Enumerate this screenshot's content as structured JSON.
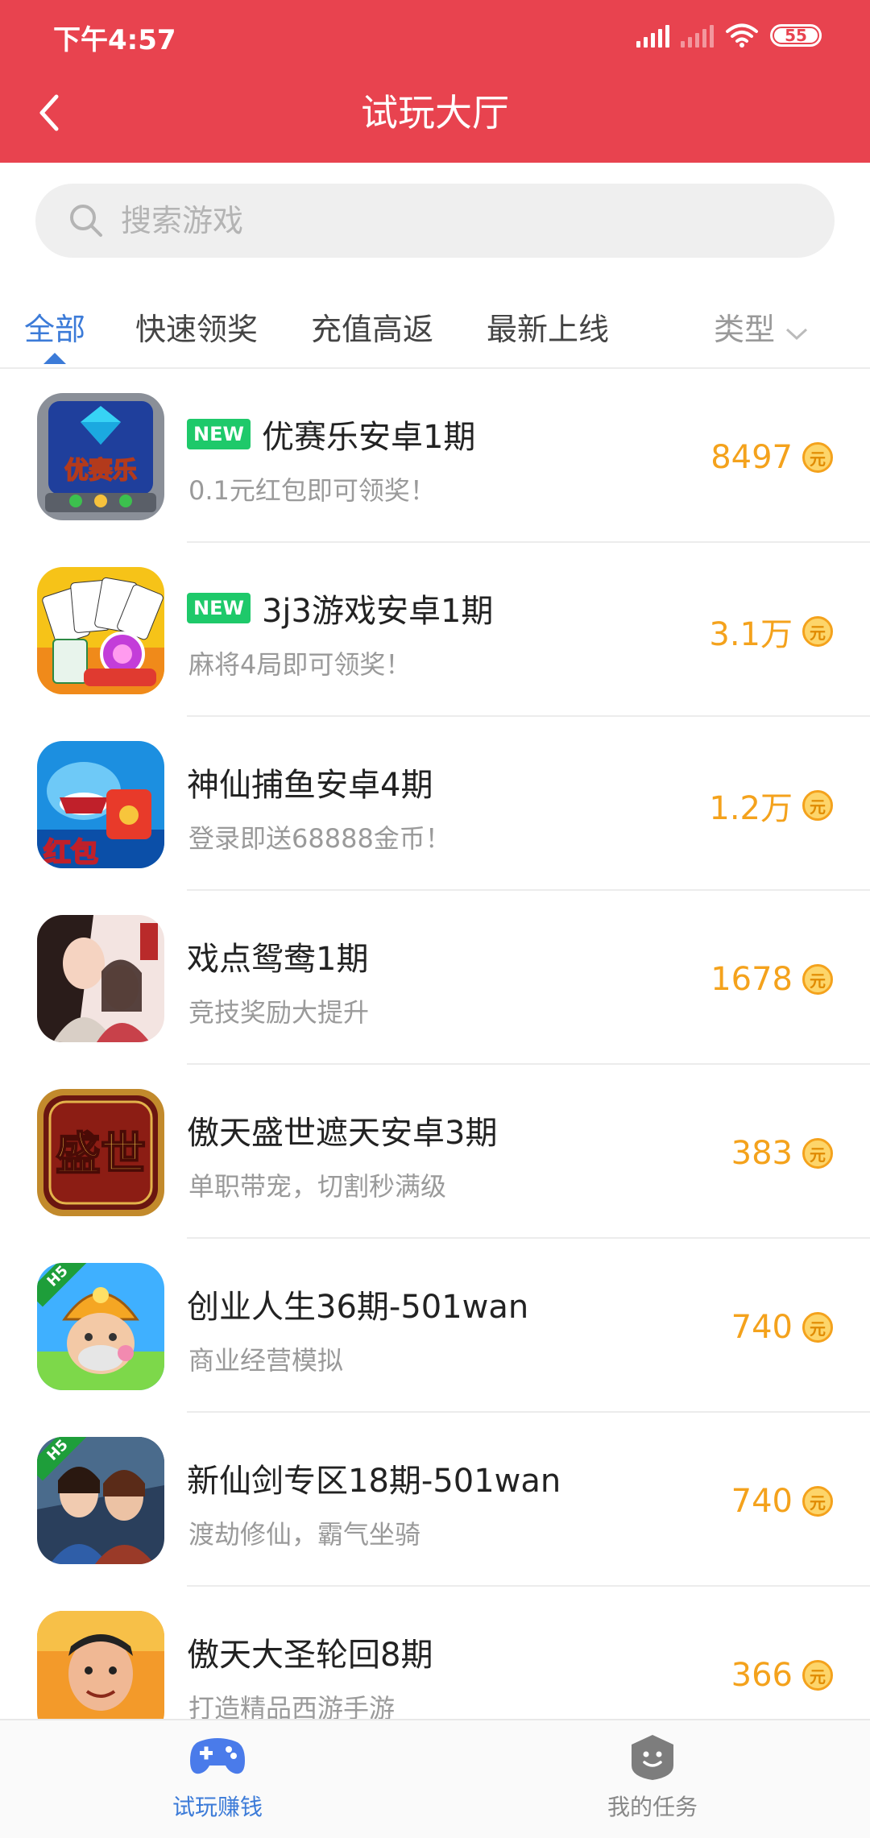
{
  "status_bar": {
    "time": "下午4:57",
    "battery": "55"
  },
  "header": {
    "title": "试玩大厅"
  },
  "search": {
    "placeholder": "搜索游戏"
  },
  "tabs": [
    {
      "label": "全部",
      "active": true
    },
    {
      "label": "快速领奖"
    },
    {
      "label": "充值高返"
    },
    {
      "label": "最新上线"
    }
  ],
  "type_filter": {
    "label": "类型"
  },
  "new_badge": "NEW",
  "h5_tag": "H5",
  "coin_glyph": "元",
  "colors": {
    "header_red": "#e8434f",
    "accent_blue": "#3c7bd8",
    "reward_orange": "#f4a21c",
    "badge_green": "#1ec96a"
  },
  "games": [
    {
      "title": "优赛乐安卓1期",
      "subtitle": "0.1元红包即可领奖！",
      "reward": "8497",
      "new": true,
      "icon": "diamond-game-icon",
      "icon_text": "优赛乐"
    },
    {
      "title": "3j3游戏安卓1期",
      "subtitle": "麻将4局即可领奖！",
      "reward": "3.1万",
      "new": true,
      "icon": "poker-cards-icon"
    },
    {
      "title": "神仙捕鱼安卓4期",
      "subtitle": "登录即送68888金币！",
      "reward": "1.2万",
      "new": false,
      "icon": "shark-fishing-icon",
      "icon_text": "红包"
    },
    {
      "title": "戏点鸳鸯1期",
      "subtitle": "竞技奖励大提升",
      "reward": "1678",
      "new": false,
      "icon": "couple-portrait-icon"
    },
    {
      "title": "傲天盛世遮天安卓3期",
      "subtitle": "单职带宠，切割秒满级",
      "reward": "383",
      "new": false,
      "icon": "shengshi-emblem-icon",
      "icon_text": "盛世"
    },
    {
      "title": "创业人生36期-501wan",
      "subtitle": "商业经营模拟",
      "reward": "740",
      "new": false,
      "icon": "miner-character-icon",
      "h5": true
    },
    {
      "title": "新仙剑专区18期-501wan",
      "subtitle": "渡劫修仙，霸气坐骑",
      "reward": "740",
      "new": false,
      "icon": "swordsman-heroes-icon",
      "h5": true
    },
    {
      "title": "傲天大圣轮回8期",
      "subtitle": "打造精品西游手游",
      "reward": "366",
      "new": false,
      "icon": "actor-face-icon"
    }
  ],
  "bottom_nav": [
    {
      "label": "试玩赚钱",
      "icon": "gamepad-icon",
      "active": true
    },
    {
      "label": "我的任务",
      "icon": "task-shield-icon",
      "active": false
    }
  ]
}
